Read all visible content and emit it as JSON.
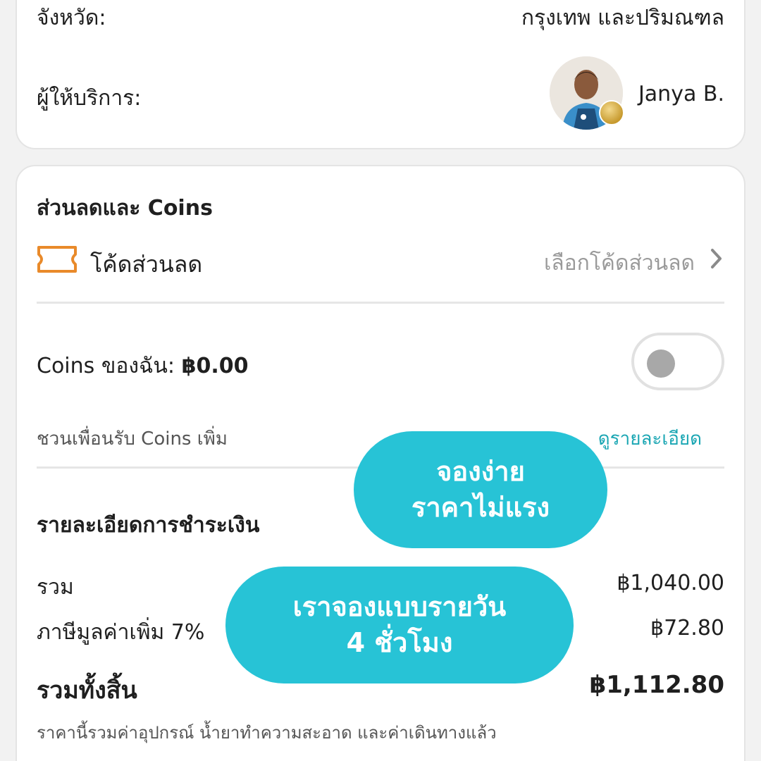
{
  "booking": {
    "province_label": "จังหวัด:",
    "province_value": "กรุงเทพ และปริมณฑล",
    "provider_label": "ผู้ให้บริการ:",
    "provider_name": "Janya B."
  },
  "discount": {
    "section_title": "ส่วนลดและ Coins",
    "code_label": "โค้ดส่วนลด",
    "code_select": "เลือกโค้ดส่วนลด",
    "coins_label": "Coins ของฉัน:",
    "coins_value": "฿0.00",
    "toggle_on": false,
    "invite_text": "ชวนเพื่อนรับ Coins เพิ่ม",
    "invite_link": "ดูรายละเอียด"
  },
  "payment": {
    "title": "รายละเอียดการชำระเงิน",
    "sum_label": "รวม",
    "sum_value": "฿1,040.00",
    "vat_label": "ภาษีมูลค่าเพิ่ม 7%",
    "vat_value": "฿72.80",
    "total_label": "รวมทั้งสิ้น",
    "total_value": "฿1,112.80",
    "note": "ราคานี้รวมค่าอุปกรณ์ น้ำยาทำความสะอาด และค่าเดินทางแล้ว"
  },
  "overlay": {
    "bubble1_line1": "จองง่าย",
    "bubble1_line2": "ราคาไม่แรง",
    "bubble2_line1": "เราจองแบบรายวัน",
    "bubble2_line2": "4 ชั่วโมง"
  },
  "colors": {
    "accent": "#27c3d6",
    "link": "#1aa6b3",
    "ticket_icon": "#e98a2a",
    "muted": "#9a9a9a"
  }
}
